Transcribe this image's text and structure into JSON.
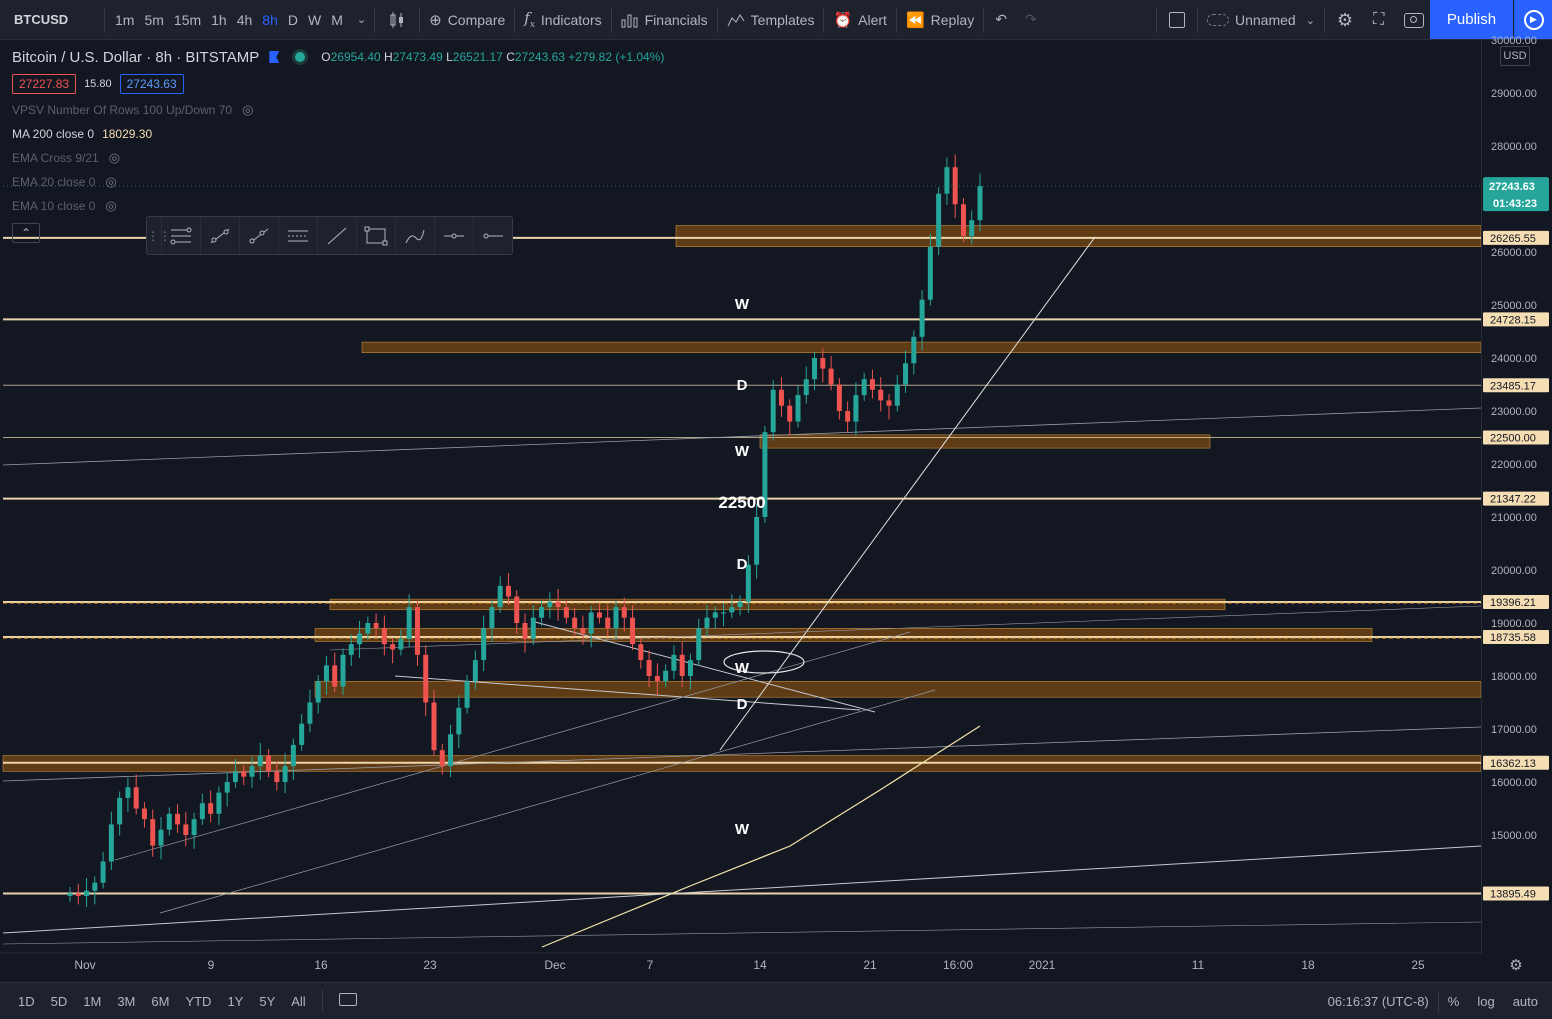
{
  "toolbar": {
    "symbol": "BTCUSD",
    "timeframes": [
      "1m",
      "5m",
      "15m",
      "1h",
      "4h",
      "8h",
      "D",
      "W",
      "M"
    ],
    "active_timeframe": "8h",
    "compare": "Compare",
    "indicators": "Indicators",
    "financials": "Financials",
    "templates": "Templates",
    "alert": "Alert",
    "replay": "Replay",
    "layout_name": "Unnamed",
    "publish": "Publish"
  },
  "legend": {
    "title": "Bitcoin / U.S. Dollar · 8h · BITSTAMP",
    "o_label": "O",
    "o": "26954.40",
    "h_label": "H",
    "h": "27473.49",
    "l_label": "L",
    "l": "26521.17",
    "c_label": "C",
    "c": "27243.63",
    "change": "+279.82 (+1.04%)",
    "bid": "27227.83",
    "spread": "15.80",
    "ask": "27243.63",
    "indicators": [
      {
        "label": "VPSV Number Of Rows 100 Up/Down 70",
        "value": "",
        "visible": false
      },
      {
        "label": "MA 200 close 0",
        "value": "18029.30",
        "visible": true
      },
      {
        "label": "EMA Cross 9/21",
        "value": "",
        "visible": false
      },
      {
        "label": "EMA 20 close 0",
        "value": "",
        "visible": false
      },
      {
        "label": "EMA 10 close 0",
        "value": "",
        "visible": false
      }
    ]
  },
  "price_axis": {
    "currency": "USD",
    "ticks": [
      "30000.00",
      "29000.00",
      "28000.00",
      "26000.00",
      "25000.00",
      "24000.00",
      "23000.00",
      "22000.00",
      "21000.00",
      "20000.00",
      "19000.00",
      "18000.00",
      "17000.00",
      "16000.00",
      "15000.00"
    ],
    "last_price": "27243.63",
    "countdown": "01:43:23",
    "level_labels": [
      "26265.55",
      "24728.15",
      "23485.17",
      "22500.00",
      "21347.22",
      "19396.21",
      "18735.58",
      "16362.13",
      "13895.49"
    ]
  },
  "time_axis": {
    "ticks": [
      "Nov",
      "9",
      "16",
      "23",
      "Dec",
      "7",
      "14",
      "21",
      "16:00",
      "2021",
      "11",
      "18",
      "25"
    ]
  },
  "annotations": [
    "W",
    "D",
    "W",
    "22500",
    "D",
    "W",
    "D",
    "W"
  ],
  "bottom": {
    "ranges": [
      "1D",
      "5D",
      "1M",
      "3M",
      "6M",
      "YTD",
      "1Y",
      "5Y",
      "All"
    ],
    "clock": "06:16:37 (UTC-8)",
    "percent": "%",
    "log": "log",
    "auto": "auto"
  },
  "colors": {
    "up": "#26a69a",
    "down": "#ef5350",
    "level_line": "#f5deb3",
    "zone": "#7a4a12",
    "accent": "#2962ff"
  },
  "chart_data": {
    "type": "candlestick",
    "symbol": "BTCUSD",
    "interval": "8h",
    "ylim": [
      13700,
      30700
    ],
    "horizontal_levels": [
      26265.55,
      24728.15,
      23485.17,
      22500,
      21347.22,
      19396.21,
      18735.58,
      16362.13,
      13895.49
    ],
    "zones": [
      {
        "from": 26100,
        "to": 26500
      },
      {
        "from": 24100,
        "to": 24300
      },
      {
        "from": 22300,
        "to": 22550
      },
      {
        "from": 19250,
        "to": 19450
      },
      {
        "from": 18650,
        "to": 18900
      },
      {
        "from": 17600,
        "to": 17900
      },
      {
        "from": 16200,
        "to": 16500
      }
    ],
    "closes": [
      13900,
      13850,
      13950,
      14100,
      14500,
      15200,
      15700,
      15900,
      15500,
      15300,
      14800,
      15100,
      15400,
      15200,
      15000,
      15300,
      15600,
      15400,
      15800,
      16000,
      16200,
      16100,
      16300,
      16500,
      16200,
      16000,
      16300,
      16700,
      17100,
      17500,
      17900,
      18200,
      17800,
      18400,
      18600,
      18800,
      19000,
      18900,
      18600,
      18500,
      18700,
      19300,
      18400,
      17500,
      16600,
      16300,
      16900,
      17400,
      17900,
      18300,
      18900,
      19300,
      19700,
      19500,
      19000,
      18700,
      19100,
      19300,
      19400,
      19300,
      19100,
      18900,
      18800,
      19200,
      19100,
      18900,
      19300,
      19100,
      18600,
      18300,
      18000,
      17900,
      18100,
      18400,
      18000,
      18300,
      18900,
      19100,
      19200,
      19200,
      19300,
      19400,
      20100,
      21000,
      22600,
      23400,
      23100,
      22800,
      23300,
      23600,
      24000,
      23800,
      23500,
      23000,
      22800,
      23300,
      23600,
      23400,
      23200,
      23100,
      23500,
      23900,
      24400,
      25100,
      26100,
      27100,
      27600,
      26900,
      26300,
      26600,
      27243.63
    ]
  }
}
